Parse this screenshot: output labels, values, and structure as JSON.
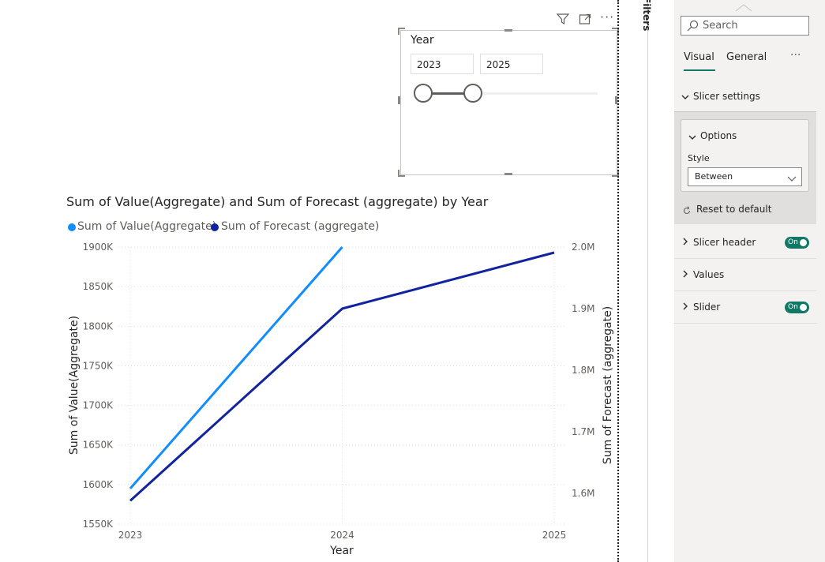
{
  "slicer": {
    "title": "Year",
    "start_value": "2023",
    "end_value": "2025",
    "range_fraction": [
      0.0,
      0.29
    ]
  },
  "visual_header": {
    "icons": [
      "filter-icon",
      "focus-mode-icon",
      "more-options-icon"
    ]
  },
  "chart": {
    "title": "Sum of Value(Aggregate) and Sum of Forecast (aggregate) by Year",
    "legend": [
      "Sum of Value(Aggregate)",
      "Sum of Forecast (aggregate)"
    ],
    "xlabel": "Year",
    "ylabel_left": "Sum of Value(Aggregate)",
    "ylabel_right": "Sum of Forecast (aggregate)"
  },
  "chart_data": {
    "type": "line",
    "title": "Sum of Value(Aggregate) and Sum of Forecast (aggregate) by Year",
    "x": [
      "2023",
      "2024",
      "2025"
    ],
    "xlabel": "Year",
    "series": [
      {
        "name": "Sum of Value(Aggregate)",
        "axis": "left",
        "color": "#118DFF",
        "values": [
          1595000,
          1900000,
          null
        ]
      },
      {
        "name": "Sum of Forecast (aggregate)",
        "axis": "right",
        "color": "#12239E",
        "values": [
          1588000,
          1900000,
          1991000
        ]
      }
    ],
    "left_axis": {
      "label": "Sum of Value(Aggregate)",
      "range": [
        1550000,
        1900000
      ],
      "ticks": [
        "1550K",
        "1600K",
        "1650K",
        "1700K",
        "1750K",
        "1800K",
        "1850K",
        "1900K"
      ]
    },
    "right_axis": {
      "label": "Sum of Forecast (aggregate)",
      "range": [
        1550000,
        2000000
      ],
      "ticks": [
        "1.6M",
        "1.7M",
        "1.8M",
        "1.9M",
        "2.0M"
      ],
      "tick_values": [
        1600000,
        1700000,
        1800000,
        1900000,
        2000000
      ]
    },
    "grid": true,
    "legend_position": "top-left"
  },
  "filters_strip": {
    "label": "Filters"
  },
  "format_pane": {
    "search_placeholder": "Search",
    "tabs": [
      "Visual",
      "General"
    ],
    "active_tab": "Visual",
    "more_label": "···",
    "slicer_settings_label": "Slicer settings",
    "options_label": "Options",
    "style_label": "Style",
    "style_value": "Between",
    "reset_label": "Reset to default",
    "sections": [
      {
        "label": "Slicer header",
        "toggle": "On"
      },
      {
        "label": "Values",
        "toggle": null
      },
      {
        "label": "Slider",
        "toggle": "On"
      }
    ]
  },
  "colors": {
    "accent": "#117865",
    "series1": "#118DFF",
    "series2": "#12239E"
  }
}
